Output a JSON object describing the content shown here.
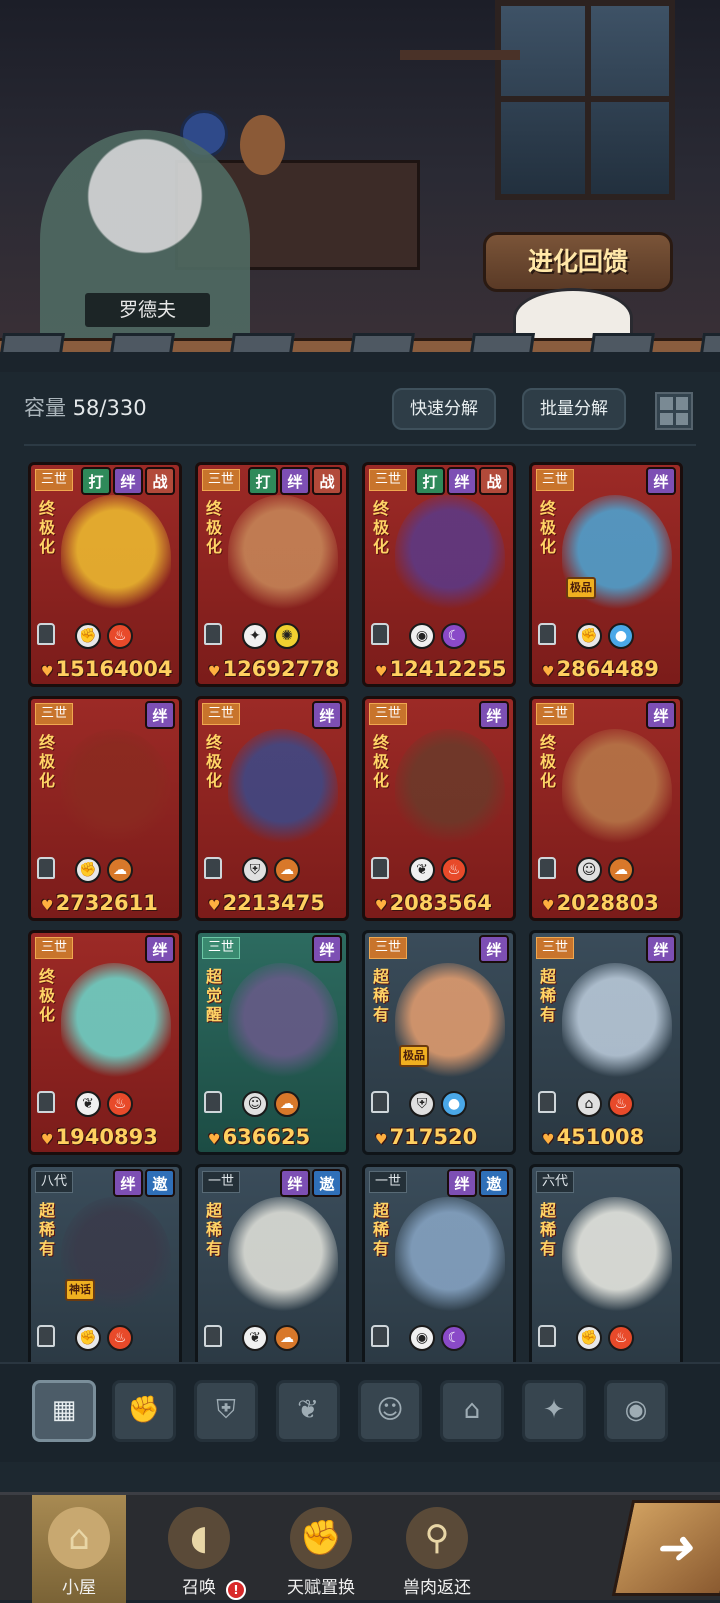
{
  "scene": {
    "npc_name": "罗德夫",
    "evolution_button": "进化回馈"
  },
  "toolbar": {
    "capacity_label": "容量",
    "capacity_value": "58/330",
    "quick_decompose": "快速分解",
    "batch_decompose": "批量分解"
  },
  "cards": [
    {
      "gen": "三世",
      "tags": [
        "打",
        "绊",
        "战"
      ],
      "rarity": "终极化",
      "power": "15164004",
      "elements": [
        "fist",
        "fire"
      ],
      "tier": "red"
    },
    {
      "gen": "三世",
      "tags": [
        "打",
        "绊",
        "战"
      ],
      "rarity": "终极化",
      "power": "12692778",
      "elements": [
        "star",
        "sun"
      ],
      "tier": "red"
    },
    {
      "gen": "三世",
      "tags": [
        "打",
        "绊",
        "战"
      ],
      "rarity": "终极化",
      "power": "12412255",
      "elements": [
        "eye",
        "moon"
      ],
      "tier": "red"
    },
    {
      "gen": "三世",
      "tags": [
        "绊"
      ],
      "rarity": "终极化",
      "badge": "极品",
      "power": "2864489",
      "elements": [
        "fist",
        "water"
      ],
      "tier": "red"
    },
    {
      "gen": "三世",
      "tags": [
        "绊"
      ],
      "rarity": "终极化",
      "power": "2732611",
      "elements": [
        "fist",
        "earth"
      ],
      "tier": "red"
    },
    {
      "gen": "三世",
      "tags": [
        "绊"
      ],
      "rarity": "终极化",
      "power": "2213475",
      "elements": [
        "shield",
        "earth"
      ],
      "tier": "red"
    },
    {
      "gen": "三世",
      "tags": [
        "绊"
      ],
      "rarity": "终极化",
      "power": "2083564",
      "elements": [
        "leaf",
        "fire"
      ],
      "tier": "red"
    },
    {
      "gen": "三世",
      "tags": [
        "绊"
      ],
      "rarity": "终极化",
      "power": "2028803",
      "elements": [
        "spirit",
        "earth"
      ],
      "tier": "red"
    },
    {
      "gen": "三世",
      "tags": [
        "绊"
      ],
      "rarity": "终极化",
      "power": "1940893",
      "elements": [
        "leaf",
        "fire"
      ],
      "tier": "red"
    },
    {
      "gen": "三世",
      "tags": [
        "绊"
      ],
      "rarity": "超觉醒",
      "power": "636625",
      "elements": [
        "spirit",
        "earth"
      ],
      "tier": "green"
    },
    {
      "gen": "三世",
      "tags": [
        "绊"
      ],
      "rarity": "超稀有",
      "badge": "极品",
      "power": "717520",
      "elements": [
        "shield",
        "water"
      ],
      "tier": "slate"
    },
    {
      "gen": "三世",
      "tags": [
        "绊"
      ],
      "rarity": "超稀有",
      "power": "451008",
      "elements": [
        "tower",
        "fire"
      ],
      "tier": "slate"
    },
    {
      "gen": "八代",
      "tags": [
        "绊",
        "遨"
      ],
      "rarity": "超稀有",
      "badge": "神话",
      "power": "",
      "elements": [
        "fist",
        "fire"
      ],
      "tier": "slate"
    },
    {
      "gen": "一世",
      "tags": [
        "绊",
        "遨"
      ],
      "rarity": "超稀有",
      "power": "",
      "elements": [
        "leaf",
        "earth"
      ],
      "tier": "slate"
    },
    {
      "gen": "一世",
      "tags": [
        "绊",
        "遨"
      ],
      "rarity": "超稀有",
      "power": "",
      "elements": [
        "eye",
        "moon"
      ],
      "tier": "slate"
    },
    {
      "gen": "六代",
      "tags": [],
      "rarity": "超稀有",
      "power": "",
      "elements": [
        "fist",
        "fire"
      ],
      "tier": "slate"
    }
  ],
  "filters": [
    "all",
    "fist",
    "shield",
    "leaf",
    "spirit",
    "tower",
    "star",
    "eye"
  ],
  "nav": {
    "home": "小屋",
    "summon": "召唤",
    "talent": "天赋置换",
    "meat": "兽肉返还",
    "alert": "!"
  },
  "colors": {
    "accent_gold": "#ffd060",
    "card_red": "#9c2a26",
    "card_green": "#2d6b60",
    "card_slate": "#3a4c5a"
  }
}
